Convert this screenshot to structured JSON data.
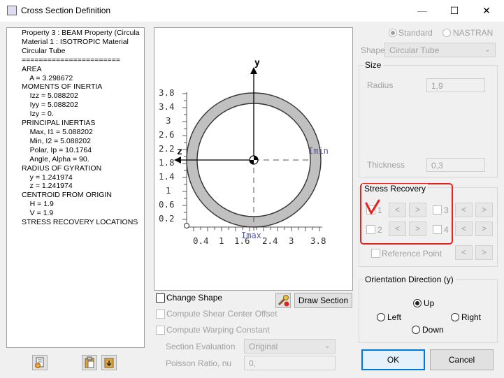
{
  "window": {
    "title": "Cross Section Definition",
    "min_glyph": "—",
    "max_glyph": "☐",
    "close_glyph": "✕"
  },
  "properties_text": "Property 3 : BEAM Property (Circula\nMaterial 1 : ISOTROPIC Material\nCircular Tube\n=======================\nAREA\n    A = 3.298672\nMOMENTS OF INERTIA\n    Izz = 5.088202\n    Iyy = 5.088202\n    Izy = 0.\nPRINCIPAL INERTIAS\n    Max, I1 = 5.088202\n    Min, I2 = 5.088202\n    Polar, Ip = 10.1764\n    Angle, Alpha = 90.\nRADIUS OF GYRATION\n    y = 1.241974\n    z = 1.241974\nCENTROID FROM ORIGIN\n    H = 1.9\n    V = 1.9\nSTRESS RECOVERY LOCATIONS",
  "canvas": {
    "y_axis_label": "y",
    "z_axis_label": "z",
    "imin_label": "Imin",
    "imax_label": "Imax",
    "y_ticks": [
      "3.8",
      "3.4",
      "3",
      "2.6",
      "2.2",
      "1.8",
      "1.4",
      "1",
      "0.6",
      "0.2"
    ],
    "x_ticks": [
      "0.4",
      "1",
      "1.6",
      "2.4",
      "3",
      "3.8"
    ],
    "ring_color": "#c0c0c0"
  },
  "left_options": {
    "change_shape": "Change Shape",
    "draw_section": "Draw Section",
    "shear_center": "Compute Shear Center Offset",
    "warping": "Compute Warping Constant",
    "section_eval_label": "Section Evaluation",
    "section_eval_value": "Original",
    "poisson_label": "Poisson Ratio, nu",
    "poisson_value": "0,"
  },
  "shape": {
    "standard": "Standard",
    "nastran": "NASTRAN",
    "shape_label": "Shape",
    "shape_value": "Circular Tube"
  },
  "size": {
    "title": "Size",
    "radius_label": "Radius",
    "radius_value": "1,9",
    "thickness_label": "Thickness",
    "thickness_value": "0,3"
  },
  "stress_recovery": {
    "title": "Stress Recovery",
    "p1": "1",
    "p2": "2",
    "p3": "3",
    "p4": "4",
    "prev": "<",
    "next": ">",
    "reference_point": "Reference Point",
    "highlight_color": "#e8211c"
  },
  "orientation": {
    "title": "Orientation Direction (y)",
    "up": "Up",
    "left": "Left",
    "right": "Right",
    "down": "Down"
  },
  "dialog": {
    "ok": "OK",
    "cancel": "Cancel"
  }
}
